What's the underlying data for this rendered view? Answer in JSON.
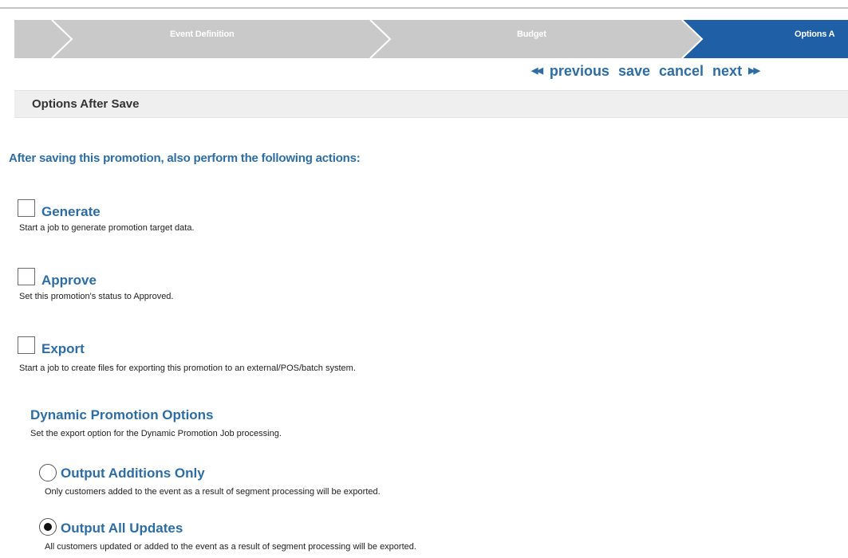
{
  "wizard": {
    "steps": [
      {
        "label": "Event Definition",
        "state": "inactive"
      },
      {
        "label": "Budget",
        "state": "inactive"
      },
      {
        "label": "Options A",
        "state": "active"
      }
    ],
    "inactive_color": "#c9c9c9",
    "active_color": "#1f5fa6"
  },
  "nav": {
    "previous": "previous",
    "save": "save",
    "cancel": "cancel",
    "next": "next",
    "prev_arrow": "◀◀",
    "next_arrow": "▶▶"
  },
  "section": {
    "title": "Options After Save"
  },
  "intro": "After saving this promotion, also perform the following actions:",
  "options": [
    {
      "title": "Generate",
      "description": "Start a job to generate promotion target data.",
      "checked": false
    },
    {
      "title": "Approve",
      "description": "Set this promotion's status to Approved.",
      "checked": false
    },
    {
      "title": "Export",
      "description": "Start a job to create files for exporting this promotion to an external/POS/batch system.",
      "checked": false
    }
  ],
  "dynamic": {
    "title": "Dynamic Promotion Options",
    "description": "Set the export option for the Dynamic Promotion Job processing.",
    "choices": [
      {
        "title": "Output Additions Only",
        "description": "Only customers added to the event as a result of segment processing will be exported.",
        "selected": false
      },
      {
        "title": "Output All Updates",
        "description": "All customers updated or added to the event as a result of segment processing will be exported.",
        "selected": true
      }
    ]
  },
  "colors": {
    "accent": "#2e6da4",
    "section_bg": "#efefef"
  }
}
